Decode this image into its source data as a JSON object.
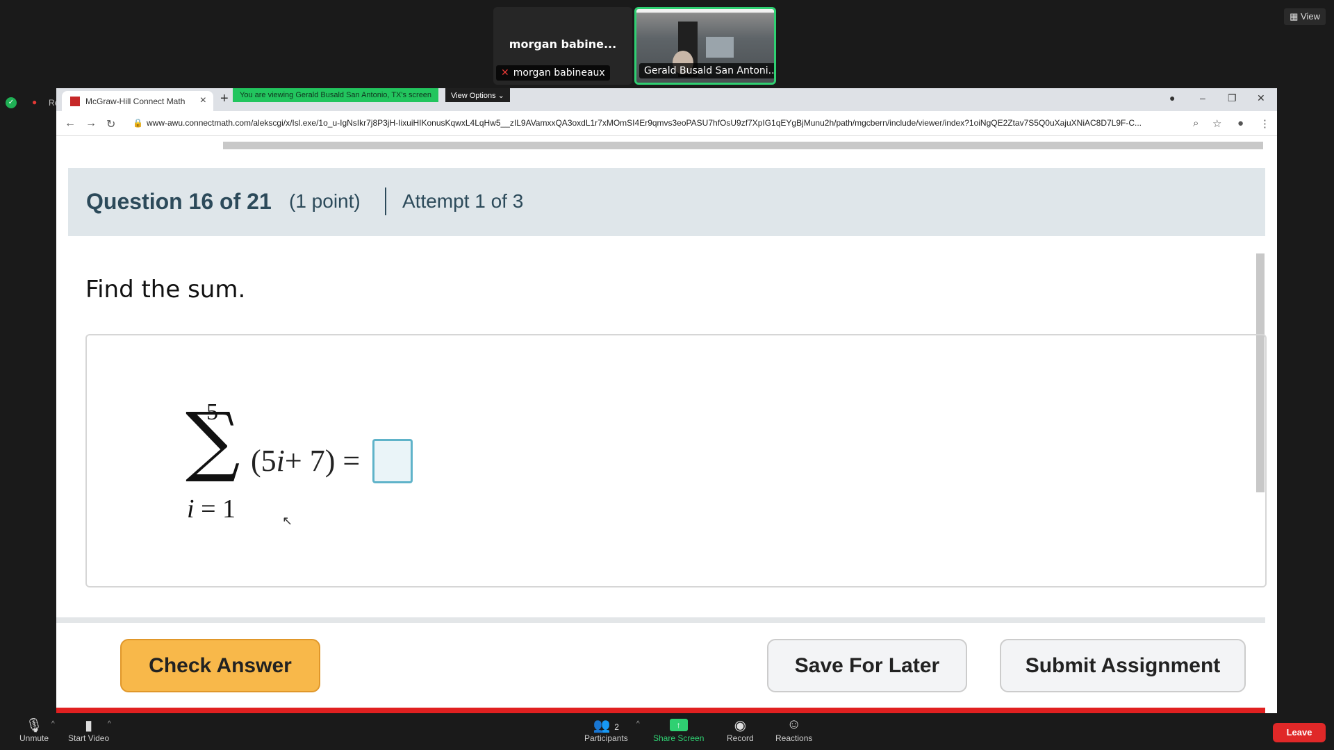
{
  "participants": {
    "tile1_name": "morgan babine...",
    "tile1_label": "morgan babineaux",
    "tile2_label": "Gerald Busald San Antoni..."
  },
  "view_button": "View",
  "sidebar": {
    "record_partial": "Re"
  },
  "browser": {
    "tab_title": "McGraw-Hill Connect Math",
    "share_banner": "You are viewing Gerald Busald San Antonio, TX's screen",
    "view_options": "View Options",
    "url": "www-awu.connectmath.com/alekscgi/x/Isl.exe/1o_u-IgNsIkr7j8P3jH-IixuiHIKonusKqwxL4LqHw5__zIL9AVamxxQA3oxdL1r7xMOmSI4Er9qmvs3eoPASU7hfOsU9zf7XpIG1qEYgBjMunu2h/path/mgcbern/include/viewer/index?1oiNgQE2Ztav7S5Q0uXajuXNiAC8D7L9F-C..."
  },
  "question": {
    "title": "Question 16 of 21",
    "points": "(1 point)",
    "attempt": "Attempt 1 of 3",
    "prompt": "Find the sum.",
    "sum_upper": "5",
    "sum_lower_var": "i",
    "sum_lower_rest": " = 1",
    "expr_open": "(5",
    "expr_var": "i",
    "expr_rest": "+ 7) ="
  },
  "buttons": {
    "check": "Check Answer",
    "save": "Save For Later",
    "submit": "Submit Assignment"
  },
  "zoom_toolbar": {
    "unmute": "Unmute",
    "start_video": "Start Video",
    "participants_count": "2",
    "participants": "Participants",
    "share_screen": "Share Screen",
    "record": "Record",
    "reactions": "Reactions",
    "leave": "Leave"
  }
}
